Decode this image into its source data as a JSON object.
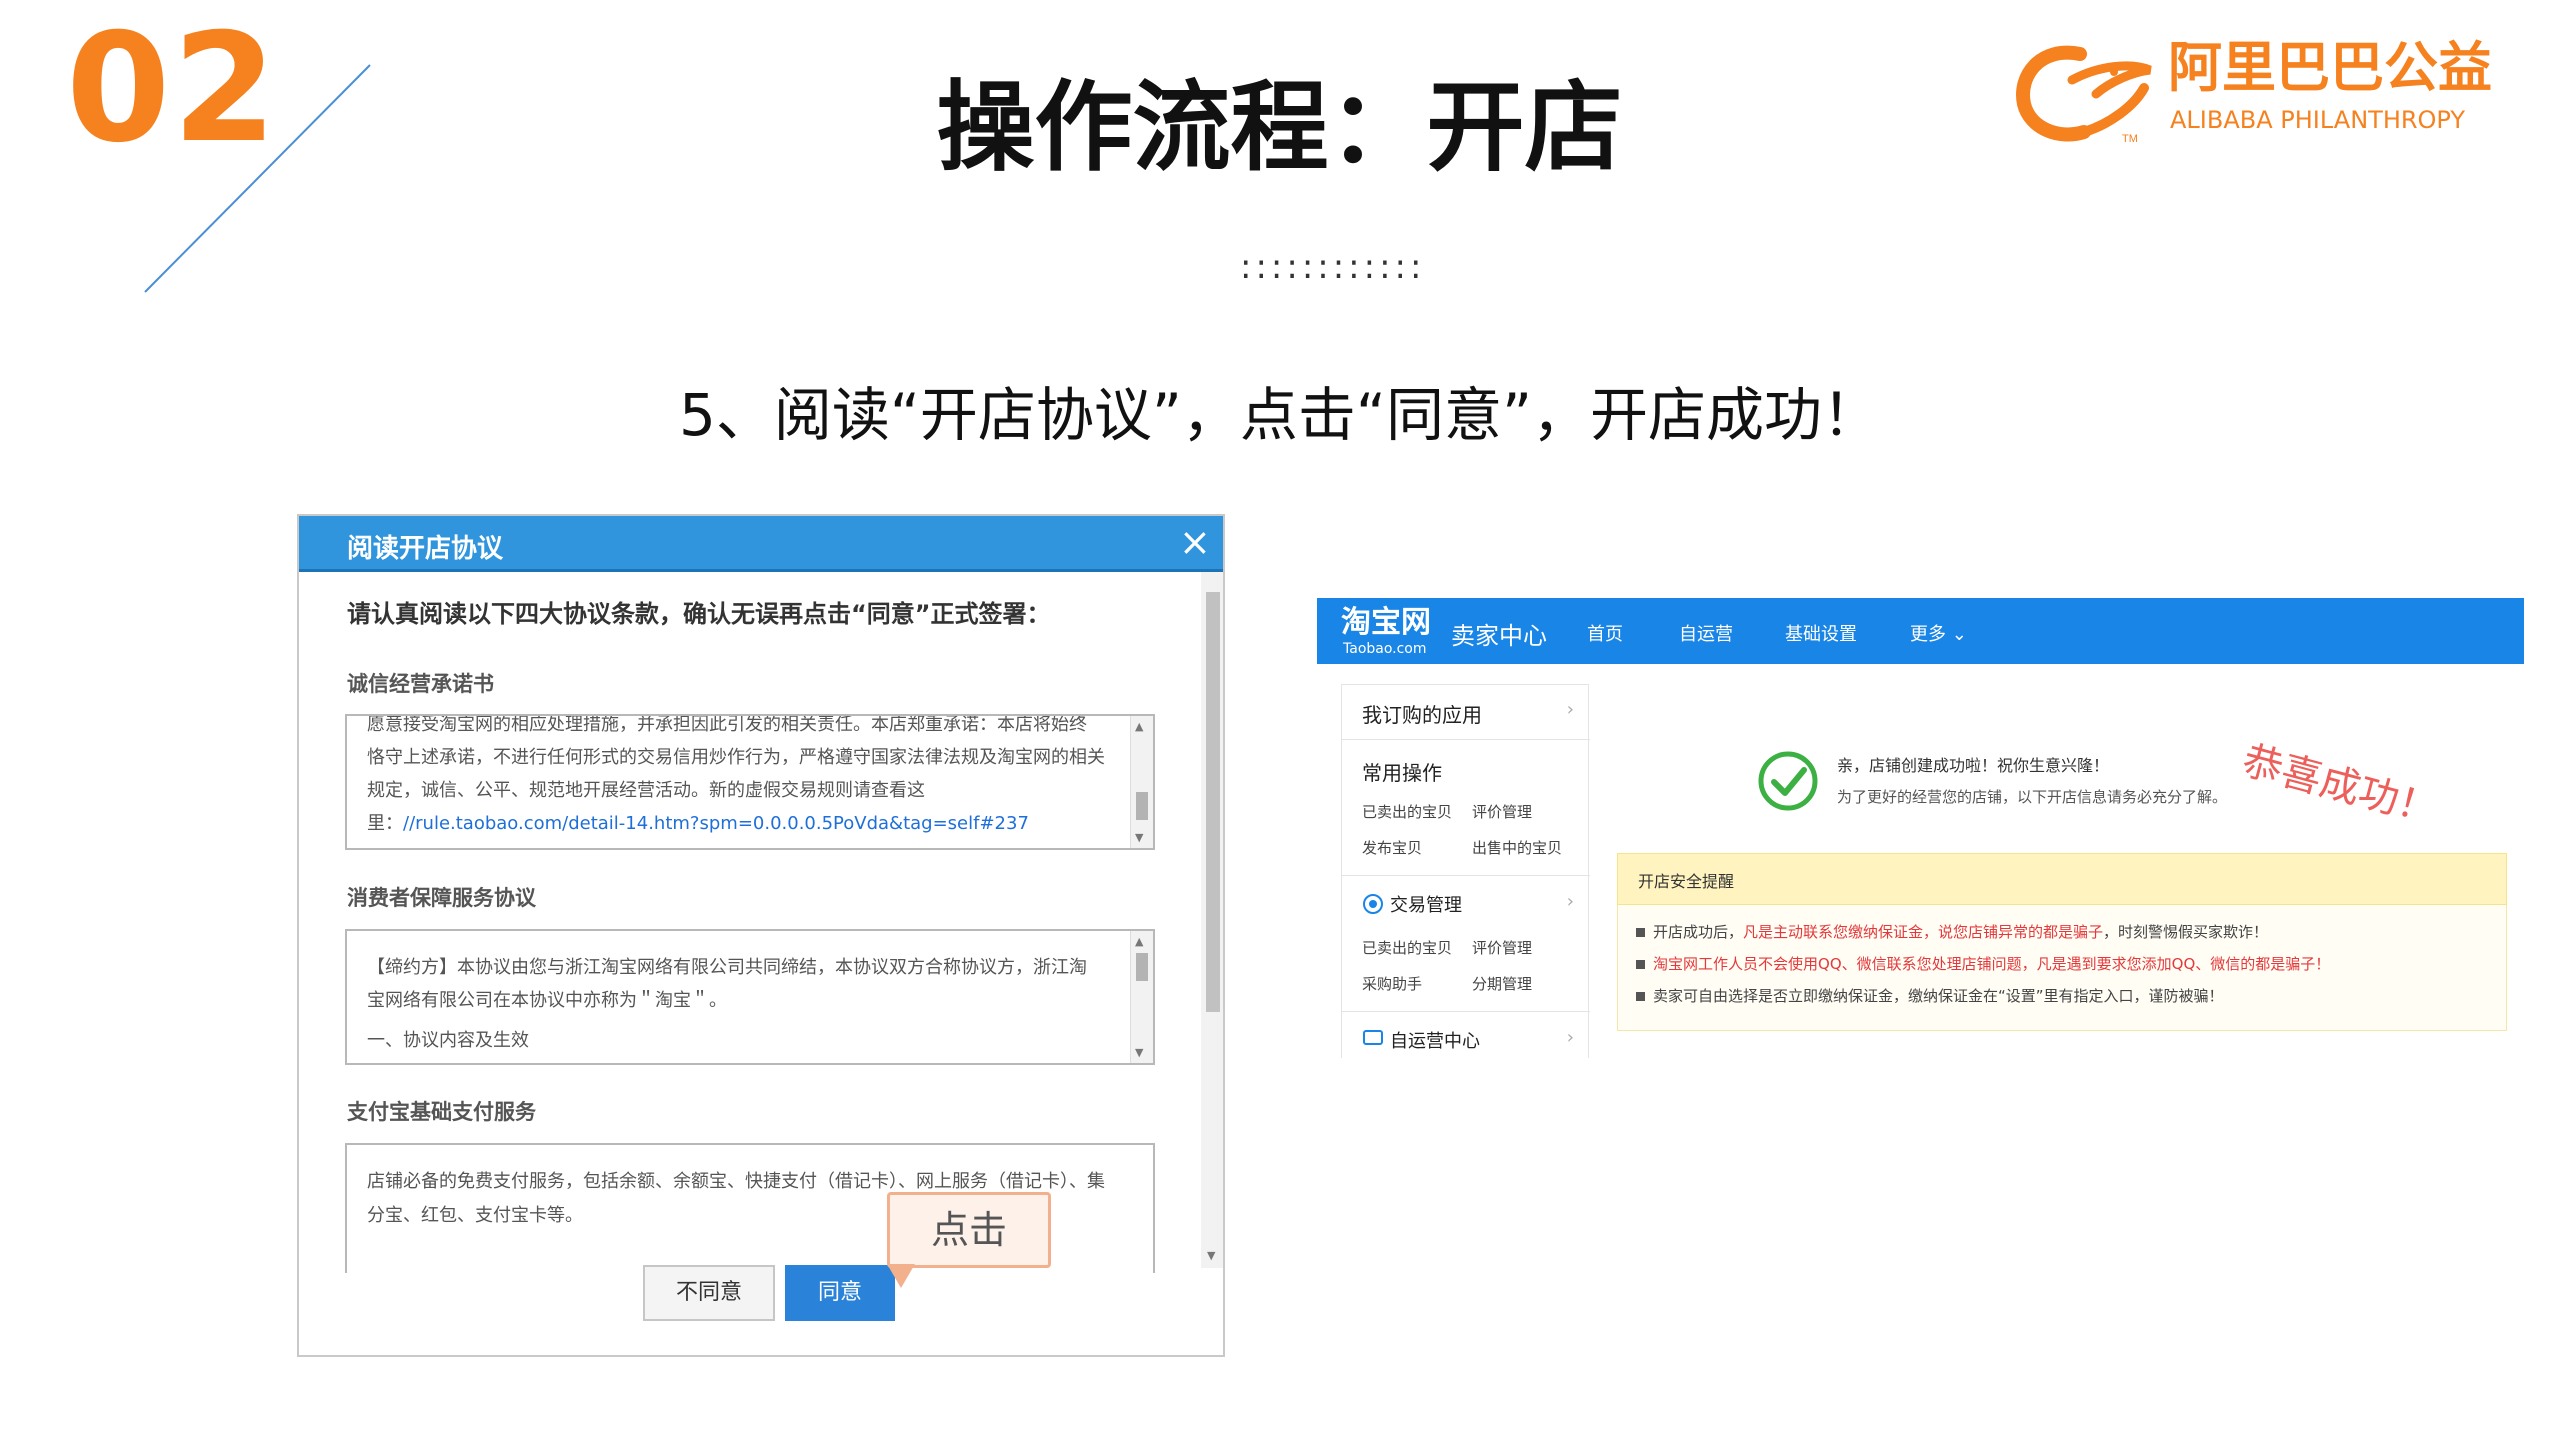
{
  "slide": {
    "number": "02",
    "title": "操作流程：开店",
    "dots": "::::::::::::",
    "step_text": "5、阅读“开店协议”，点击“同意”，开店成功！"
  },
  "logo": {
    "name_cn": "阿里巴巴公益",
    "name_en": "ALIBABA PHILANTHROPY",
    "tm": "TM",
    "brand_color": "#f5811f"
  },
  "dialog": {
    "title": "阅读开店协议",
    "close_icon": "×",
    "intro": "请认真阅读以下四大协议条款，确认无误再点击“同意”正式签署：",
    "sections": [
      {
        "title": "诚信经营承诺书",
        "lines": [
          "愿意接受淘宝网的相应处理措施，并承担因此引发的相关责任。本店郑重承诺：本店将始终",
          "恪守上述承诺，不进行任何形式的交易信用炒作行为，严格遵守国家法律法规及淘宝网的相关",
          "规定，诚信、公平、规范地开展经营活动。新的虚假交易规则请查看这",
          "里："
        ],
        "link": "//rule.taobao.com/detail-14.htm?spm=0.0.0.0.5PoVda&tag=self#237"
      },
      {
        "title": "消费者保障服务协议",
        "lines": [
          "【缔约方】本协议由您与浙江淘宝网络有限公司共同缔结，本协议双方合称协议方，浙江淘",
          "宝网络有限公司在本协议中亦称为＂淘宝＂。",
          "一、协议内容及生效"
        ]
      },
      {
        "title": "支付宝基础支付服务",
        "lines": [
          "店铺必备的免费支付服务，包括余额、余额宝、快捷支付（借记卡）、网上服务（借记卡）、集",
          "分宝、红包、支付宝卡等。"
        ]
      }
    ],
    "disagree_label": "不同意",
    "agree_label": "同意",
    "callout": "点击"
  },
  "taobao": {
    "logo": "淘宝网",
    "logo_sub": "Taobao.com",
    "seller_center": "卖家中心",
    "nav": [
      "首页",
      "自运营",
      "基础设置",
      "更多 ⌄"
    ],
    "sidebar": {
      "my_apps": "我订购的应用",
      "common_ops": "常用操作",
      "common_items": [
        "已卖出的宝贝",
        "评价管理",
        "发布宝贝",
        "出售中的宝贝"
      ],
      "trade_mgmt": "交易管理",
      "trade_items": [
        "已卖出的宝贝",
        "评价管理",
        "采购助手",
        "分期管理"
      ],
      "self_ops": "自运营中心"
    },
    "success_msg": "亲，店铺创建成功啦！祝你生意兴隆！",
    "success_sub": "为了更好的经营您的店铺，以下开店信息请务必充分了解。",
    "congrats": "恭喜成功！",
    "notice_title": "开店安全提醒",
    "notices": [
      {
        "a": "开店成功后，",
        "b": "凡是主动联系您缴纳保证金，说您店铺异常的都是骗子",
        "c": "，时刻警惕假买家欺诈！"
      },
      {
        "a": "",
        "b": "淘宝网工作人员",
        "c": "不会使用QQ、微信联系您处理店铺问题，凡是遇到要求您添加QQ、微信的都是骗子！"
      },
      {
        "a": "卖家可自由选择是否立即缴纳保证金，缴纳保证金在“设置”里有指定入口，谨防被骗！",
        "b": "",
        "c": ""
      }
    ]
  }
}
